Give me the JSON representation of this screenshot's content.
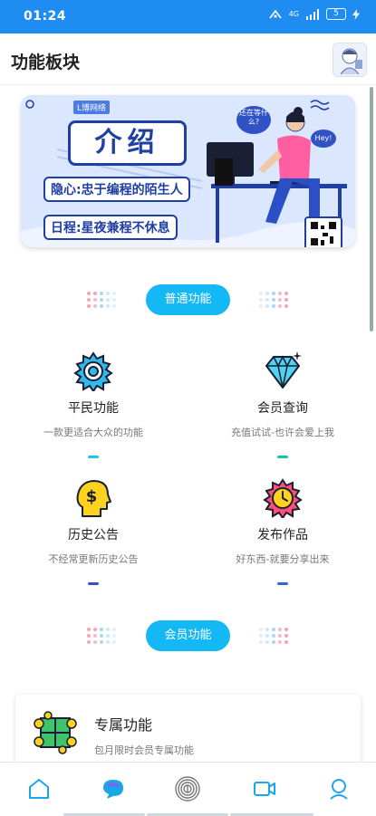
{
  "status": {
    "time": "01:24",
    "network": "4G",
    "battery": "5"
  },
  "header": {
    "title": "功能板块",
    "avatar_icon": "anime-avatar-icon"
  },
  "banner": {
    "logo_text": "L博网络",
    "title": "介绍",
    "line1": "隐心:忠于编程的陌生人",
    "line2": "日程:星夜兼程不休息",
    "bubble1": "还在等什么?",
    "bubble2": "Hey!"
  },
  "sections": {
    "normal_label": "普通功能",
    "member_label": "会员功能"
  },
  "functions": [
    {
      "title": "平民功能",
      "desc": "一款更适合大众的功能",
      "icon": "gear-icon",
      "accent": "#1ec4ef"
    },
    {
      "title": "会员查询",
      "desc": "充值试试-也许会爱上我",
      "icon": "diamond-icon",
      "accent": "#15c0a8"
    },
    {
      "title": "历史公告",
      "desc": "不经常更新历史公告",
      "icon": "head-dollar-icon",
      "accent": "#3a4ec8"
    },
    {
      "title": "发布作品",
      "desc": "好东西-就要分享出来",
      "icon": "gear-clock-icon",
      "accent": "#2f6ad8"
    }
  ],
  "member_card": {
    "title": "专属功能",
    "desc": "包月限时会员专属功能",
    "icon": "puzzle-hands-icon"
  },
  "nav": [
    {
      "name": "home-icon"
    },
    {
      "name": "chat-icon"
    },
    {
      "name": "fingerprint-icon"
    },
    {
      "name": "video-icon"
    },
    {
      "name": "profile-icon"
    }
  ],
  "colors": {
    "primary": "#14b8f4",
    "status_bar": "#1e8cf0",
    "nav_active": "#1aa7e8"
  }
}
